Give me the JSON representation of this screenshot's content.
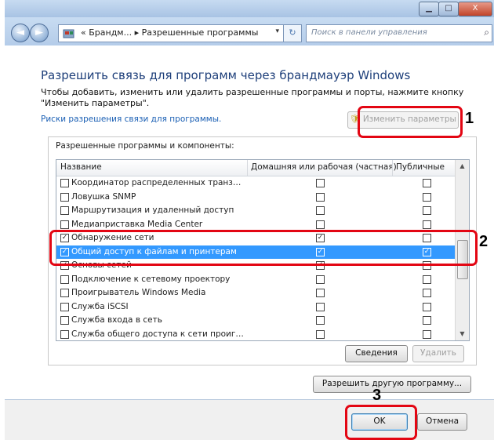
{
  "window": {
    "min_label": "▁",
    "max_label": "□",
    "close_label": "X"
  },
  "navbar": {
    "back_label": "◄",
    "forward_label": "►",
    "address": "« Брандм... ▸ Разрешенные программы",
    "dropdown_label": "▾",
    "refresh_label": "⁺⁄₊",
    "search_placeholder": "Поиск в панели управления",
    "search_icon": "magnifier-icon"
  },
  "content": {
    "title": "Разрешить связь для программ через брандмауэр Windows",
    "description": "Чтобы добавить, изменить или удалить разрешенные программы и порты, нажмите кнопку \"Изменить параметры\".",
    "risk_link": "Риски разрешения связи для программы.",
    "change_settings_button": "Изменить параметры",
    "group_title": "Разрешенные программы и компоненты:",
    "columns": [
      "Название",
      "Домашняя или рабочая (частная)",
      "Публичные"
    ],
    "rows": [
      {
        "name": "Координатор распределенных транзакц...",
        "enabled": "☐",
        "home": "☐",
        "public": "☐",
        "selected": false
      },
      {
        "name": "Ловушка SNMP",
        "enabled": "☐",
        "home": "☐",
        "public": "☐",
        "selected": false
      },
      {
        "name": "Маршрутизация и удаленный доступ",
        "enabled": "☐",
        "home": "☐",
        "public": "☐",
        "selected": false
      },
      {
        "name": "Медиаприставка Media Center",
        "enabled": "☐",
        "home": "☐",
        "public": "☐",
        "selected": false
      },
      {
        "name": "Обнаружение сети",
        "enabled": "✓",
        "home": "✓",
        "public": "☐",
        "selected": false
      },
      {
        "name": "Общий доступ к файлам и принтерам",
        "enabled": "✓",
        "home": "✓",
        "public": "✓",
        "selected": true
      },
      {
        "name": "Основы сетей",
        "enabled": "✓",
        "home": "✓",
        "public": "☐",
        "selected": false
      },
      {
        "name": "Подключение к сетевому проектору",
        "enabled": "☐",
        "home": "☐",
        "public": "☐",
        "selected": false
      },
      {
        "name": "Проигрыватель Windows Media",
        "enabled": "☐",
        "home": "☐",
        "public": "☐",
        "selected": false
      },
      {
        "name": "Служба iSCSI",
        "enabled": "☐",
        "home": "☐",
        "public": "☐",
        "selected": false
      },
      {
        "name": "Служба входа в сеть",
        "enabled": "☐",
        "home": "☐",
        "public": "☐",
        "selected": false
      },
      {
        "name": "Служба общего доступа к сети проигры...",
        "enabled": "☐",
        "home": "☐",
        "public": "☐",
        "selected": false
      }
    ],
    "details_button": "Сведения",
    "delete_button": "Удалить",
    "allow_other_button": "Разрешить другую программу..."
  },
  "footer": {
    "ok_button": "OK",
    "cancel_button": "Отмена"
  },
  "annotations": {
    "step1": "1",
    "step2": "2",
    "step3": "3",
    "highlight_color": "#e30613"
  },
  "colors": {
    "selection": "#3399ff",
    "title_color": "#1e3f7a",
    "link_color": "#1a5fb4"
  }
}
